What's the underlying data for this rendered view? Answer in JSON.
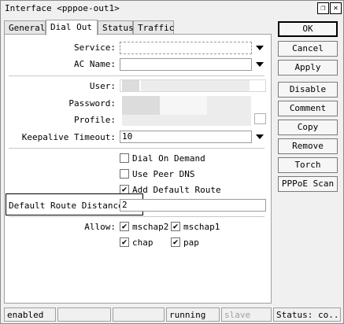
{
  "window": {
    "title": "Interface <pppoe-out1>",
    "restore_glyph": "❐",
    "close_glyph": "✕"
  },
  "tabs": [
    {
      "label": "General"
    },
    {
      "label": "Dial Out"
    },
    {
      "label": "Status"
    },
    {
      "label": "Traffic"
    }
  ],
  "form": {
    "service_label": "Service:",
    "service_value": "",
    "ac_name_label": "AC Name:",
    "ac_name_value": "",
    "user_label": "User:",
    "password_label": "Password:",
    "profile_label": "Profile:",
    "keepalive_label": "Keepalive Timeout:",
    "keepalive_value": "10",
    "default_route_distance_label": "Default Route Distance:",
    "default_route_distance_value": "2",
    "allow_label": "Allow:"
  },
  "checkboxes": {
    "dial_on_demand": {
      "label": "Dial On Demand",
      "checked": false
    },
    "use_peer_dns": {
      "label": "Use Peer DNS",
      "checked": false
    },
    "add_default_route": {
      "label": "Add Default Route",
      "checked": true
    },
    "mschap2": {
      "label": "mschap2",
      "checked": true
    },
    "mschap1": {
      "label": "mschap1",
      "checked": true
    },
    "chap": {
      "label": "chap",
      "checked": true
    },
    "pap": {
      "label": "pap",
      "checked": true
    }
  },
  "check_glyph": "✔",
  "buttons": {
    "ok": "OK",
    "cancel": "Cancel",
    "apply": "Apply",
    "disable": "Disable",
    "comment": "Comment",
    "copy": "Copy",
    "remove": "Remove",
    "torch": "Torch",
    "pppoe_scan": "PPPoE Scan"
  },
  "statusbar": {
    "state": "enabled",
    "running": "running",
    "slave": "slave",
    "status": "Status: co..."
  }
}
